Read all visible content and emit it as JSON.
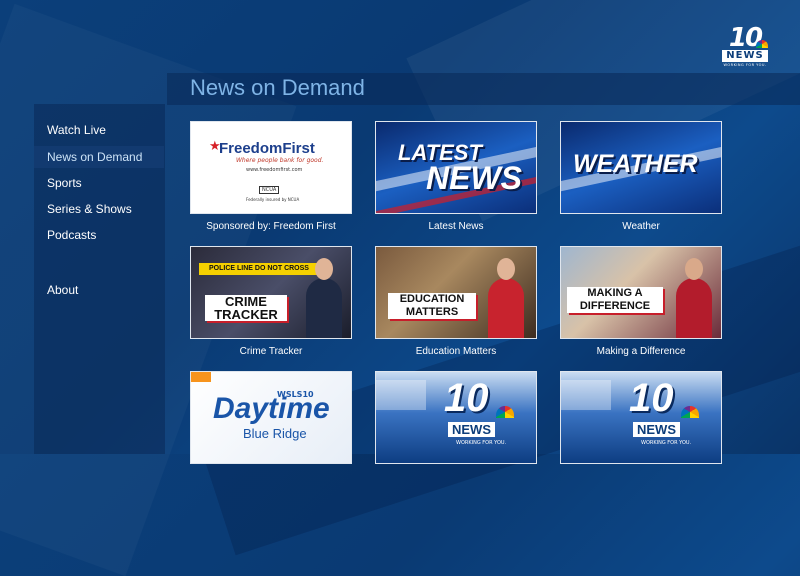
{
  "header": {
    "title": "News on Demand",
    "logo": {
      "number": "10",
      "wordmark": "NEWS",
      "tagline": "WORKING FOR YOU."
    }
  },
  "sidebar": {
    "items": [
      {
        "label": "Watch Live",
        "active": false
      },
      {
        "label": "News on Demand",
        "active": true
      },
      {
        "label": "Sports",
        "active": false
      },
      {
        "label": "Series & Shows",
        "active": false
      },
      {
        "label": "Podcasts",
        "active": false
      },
      {
        "label": "About",
        "active": false
      }
    ]
  },
  "tiles": [
    {
      "caption": "Sponsored by: Freedom First",
      "art": {
        "brand": "FreedomFirst",
        "slogan": "Where people bank for good.",
        "url": "www.freedomfirst.com",
        "ncua": "NCUA",
        "fine": "Federally insured by NCUA"
      }
    },
    {
      "caption": "Latest News",
      "art": {
        "line1": "LATEST",
        "line2": "NEWS"
      }
    },
    {
      "caption": "Weather",
      "art": {
        "line1": "WEATHER"
      }
    },
    {
      "caption": "Crime Tracker",
      "art": {
        "tape": "POLICE LINE DO NOT CROSS",
        "line1": "CRIME",
        "line2": "TRACKER"
      }
    },
    {
      "caption": "Education Matters",
      "art": {
        "line1": "EDUCATION",
        "line2": "MATTERS"
      }
    },
    {
      "caption": "Making a Difference",
      "art": {
        "line1": "MAKING A",
        "line2": "DIFFERENCE"
      }
    },
    {
      "caption": "",
      "art": {
        "line1": "Daytime",
        "line2": "Blue Ridge",
        "badge": "WSLS10"
      }
    },
    {
      "caption": "",
      "art": {
        "number": "10",
        "wordmark": "NEWS",
        "tagline": "WORKING FOR YOU."
      }
    },
    {
      "caption": "",
      "art": {
        "number": "10",
        "wordmark": "NEWS",
        "tagline": "WORKING FOR YOU."
      }
    }
  ],
  "colors": {
    "background": "#0b3f7a",
    "title": "#7fb4e6",
    "active_nav": "#123a70"
  }
}
